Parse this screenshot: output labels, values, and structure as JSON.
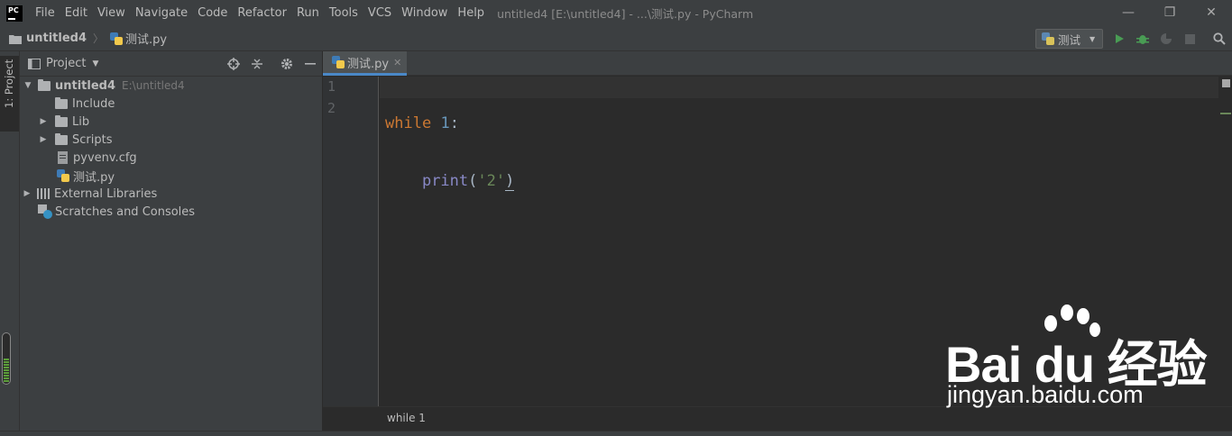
{
  "app": {
    "logo_text": "PC",
    "window_title": "untitled4 [E:\\untitled4] - ...\\测试.py - PyCharm"
  },
  "menu": [
    "File",
    "Edit",
    "View",
    "Navigate",
    "Code",
    "Refactor",
    "Run",
    "Tools",
    "VCS",
    "Window",
    "Help"
  ],
  "window_controls": {
    "minimize": "—",
    "restore": "❐",
    "close": "✕"
  },
  "navbar": {
    "project": "untitled4",
    "file": "测试.py",
    "run_config": "测试"
  },
  "left_strip": {
    "project_tab": "1: Project"
  },
  "project_panel": {
    "title": "Project",
    "tree": {
      "root": {
        "label": "untitled4",
        "hint": "E:\\untitled4"
      },
      "include": "Include",
      "lib": "Lib",
      "scripts": "Scripts",
      "cfg": "pyvenv.cfg",
      "py": "测试.py",
      "ext_libs": "External Libraries",
      "scratches": "Scratches and Consoles"
    }
  },
  "editor": {
    "tab_label": "测试.py",
    "lines": [
      {
        "number": "1",
        "tokens": {
          "kw": "while",
          "num": "1",
          "colon": ":"
        }
      },
      {
        "number": "2",
        "tokens": {
          "indent": "    ",
          "fn": "print",
          "open": "(",
          "str": "'2'",
          "close": ")"
        }
      }
    ],
    "breadcrumb": "while 1"
  },
  "watermark": {
    "brand": "Bai du 经验",
    "url": "jingyan.baidu.com"
  },
  "colors": {
    "bg_editor": "#2b2b2b",
    "bg_panel": "#3c3f41",
    "keyword": "#cc7832",
    "number": "#6897bb",
    "string": "#6a8759",
    "builtin": "#8888c6",
    "run_green": "#499c54",
    "tab_accent": "#4a88c7"
  }
}
